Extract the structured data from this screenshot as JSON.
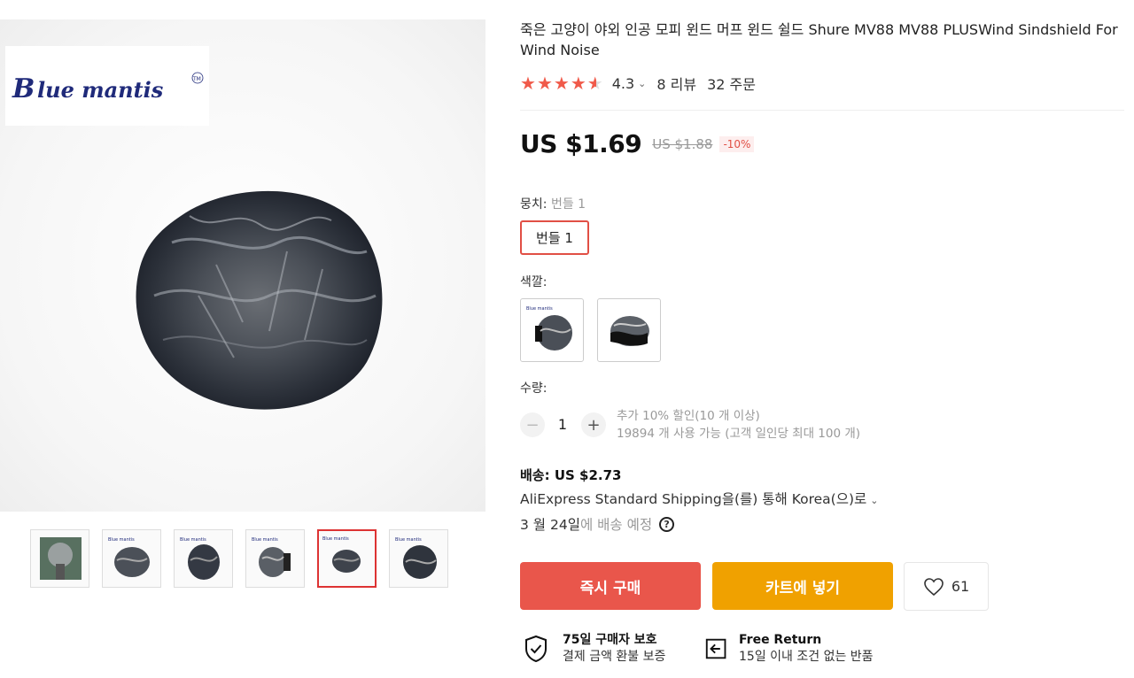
{
  "product": {
    "title": "죽은 고양이 야외 인공 모피 윈드 머프 윈드 쉴드 Shure MV88 MV88 PLUSWind Sindshield For Wind Noise",
    "rating": "4.3",
    "rating_stars": 4.5,
    "reviews": "8 리뷰",
    "orders": "32 주문"
  },
  "brand": {
    "logo_text": "Blue mantis",
    "logo_tm": "TM"
  },
  "price": {
    "current": "US $1.69",
    "original": "US $1.88",
    "discount": "-10%"
  },
  "bundle": {
    "label": "뭉치:",
    "selected": "번들 1",
    "option": "번들 1"
  },
  "color": {
    "label": "색깔:"
  },
  "quantity": {
    "label": "수량:",
    "value": "1",
    "minus": "−",
    "plus": "+",
    "promo": "추가 10% 할인(10 개 이상)",
    "available": "19894 개 사용 가능 (고객 일인당 최대 100 개)"
  },
  "shipping": {
    "title": "배송: US $2.73",
    "method": "AliExpress Standard Shipping을(를) 통해 Korea(으)로",
    "date": "3 월 24일",
    "date_suffix": "에 배송 예정",
    "help": "?"
  },
  "actions": {
    "buy_now": "즉시 구매",
    "add_to_cart": "카트에 넣기",
    "wishlist_count": "61"
  },
  "guarantees": [
    {
      "title": "75일 구매자 보호",
      "sub": "결제 금액 환불 보증"
    },
    {
      "title": "Free Return",
      "sub": "15일 이내 조건 없는 반품"
    }
  ],
  "icons": {
    "star": "★",
    "chevron": "⌄"
  },
  "colors": {
    "accent_red": "#e9564b",
    "accent_orange": "#f0a100",
    "star_red": "#f05a4a"
  }
}
